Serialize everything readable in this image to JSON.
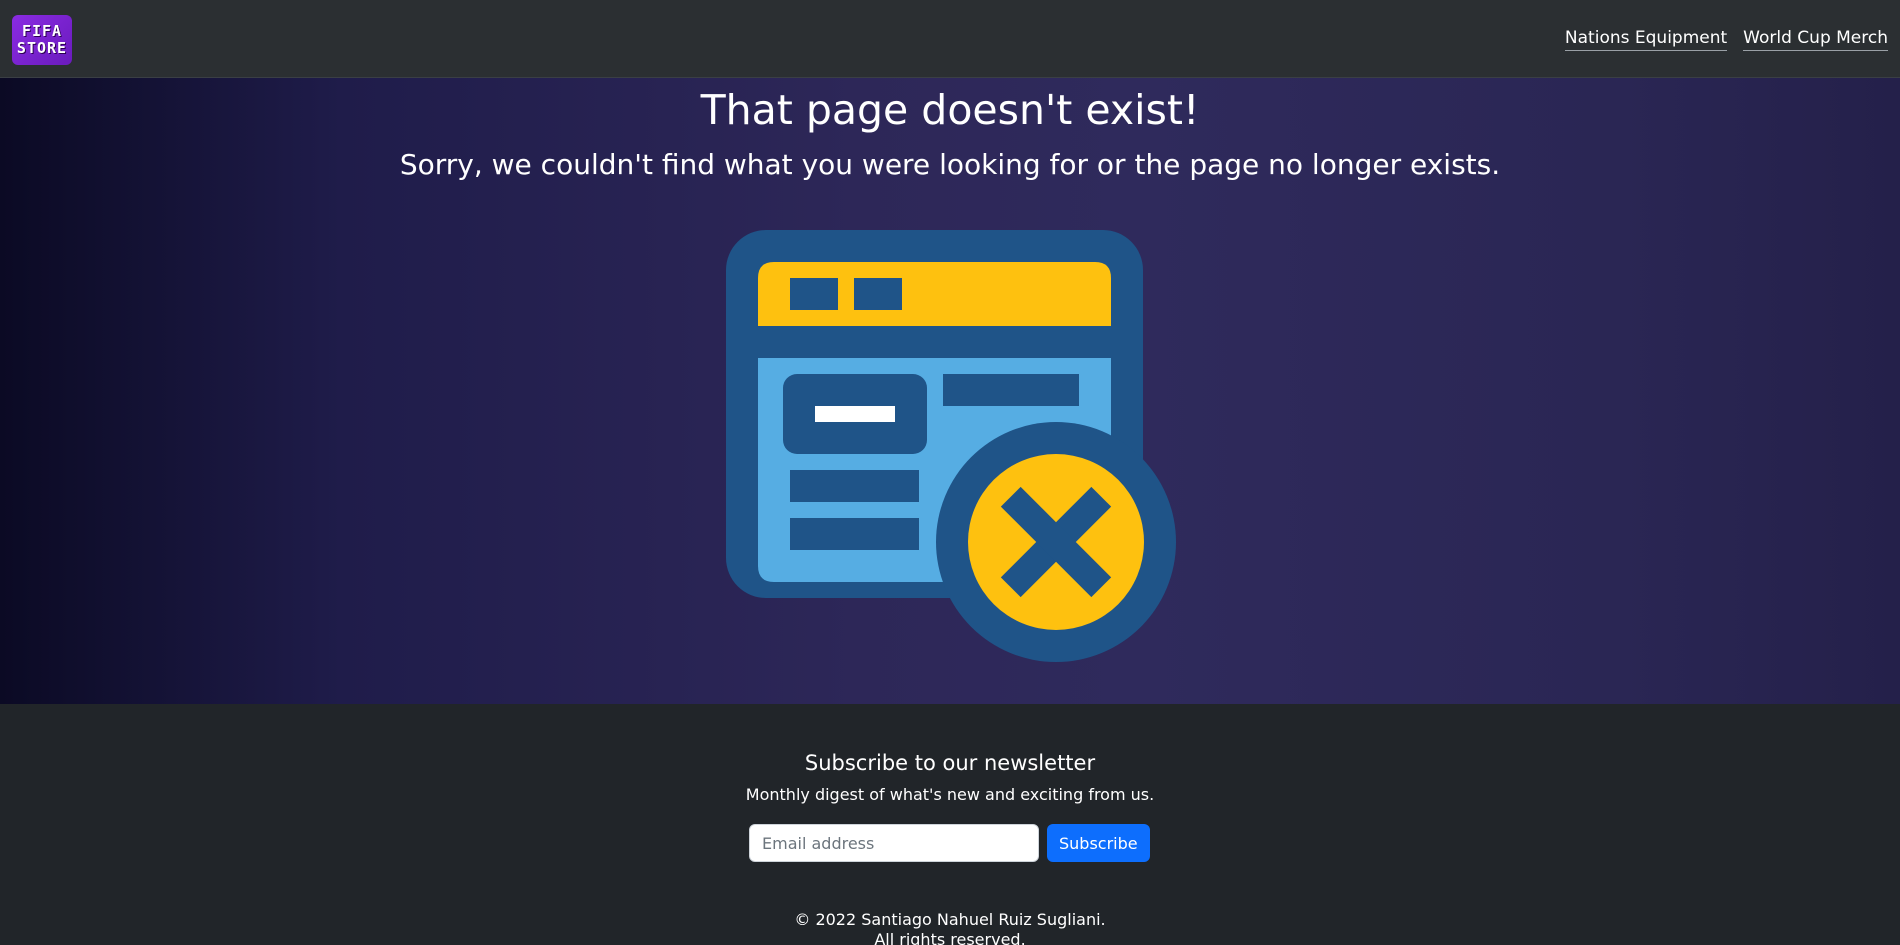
{
  "navbar": {
    "logo_line1": "FIFA",
    "logo_line2": "STORE",
    "links": [
      {
        "label": "Nations Equipment"
      },
      {
        "label": "World Cup Merch"
      }
    ]
  },
  "hero": {
    "title": "That page doesn't exist!",
    "subtitle": "Sorry, we couldn't find what you were looking for or the page no longer exists.",
    "illustration_icon": "broken-page-x-icon",
    "colors": {
      "dark_blue": "#1f5488",
      "light_blue": "#56ade3",
      "yellow": "#fec10f",
      "white": "#ffffff"
    }
  },
  "footer": {
    "newsletter_title": "Subscribe to our newsletter",
    "newsletter_desc": "Monthly digest of what's new and exciting from us.",
    "email_placeholder": "Email address",
    "email_value": "",
    "subscribe_label": "Subscribe",
    "copyright_line1": "© 2022 Santiago Nahuel Ruiz Sugliani.",
    "copyright_line2": "All rights reserved."
  }
}
